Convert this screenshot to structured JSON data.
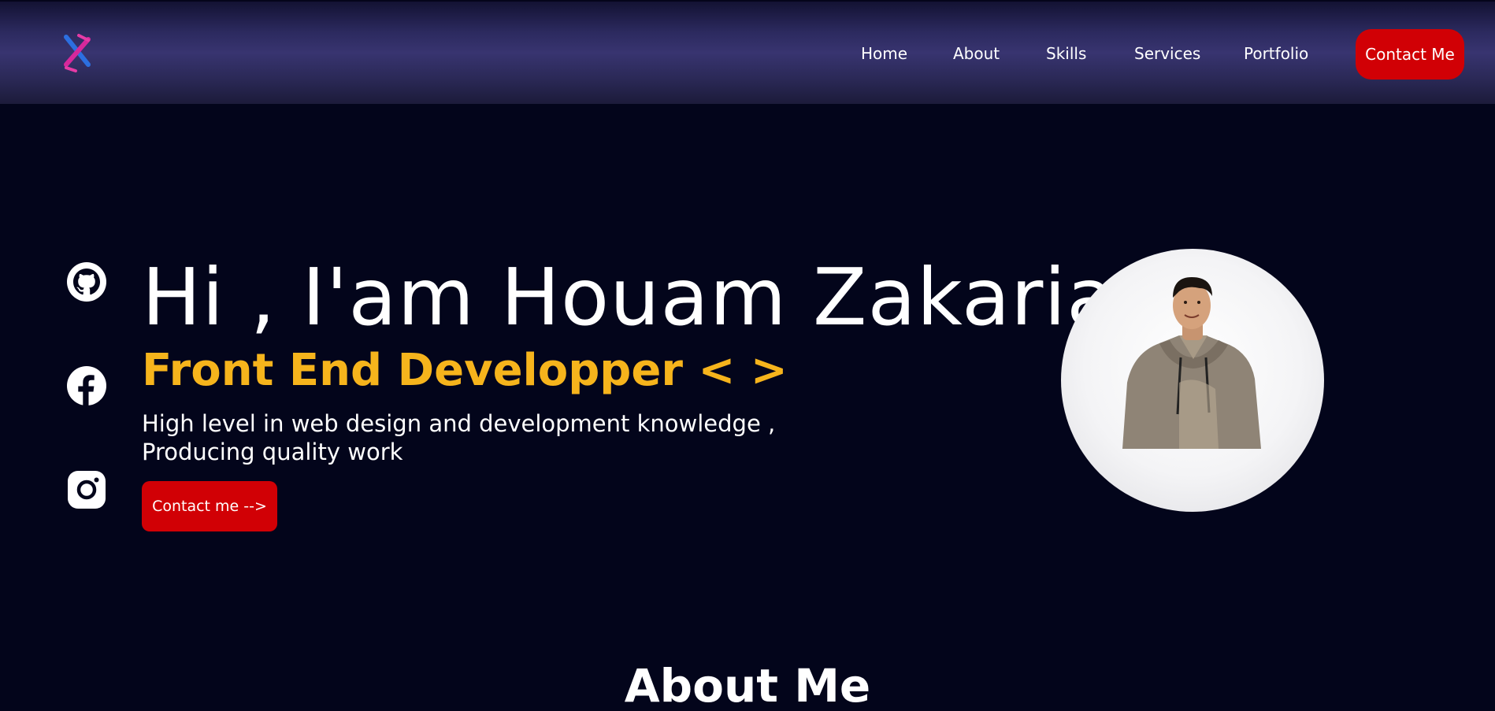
{
  "navbar": {
    "logo_icon": "x-logo-icon",
    "links": [
      {
        "label": "Home"
      },
      {
        "label": "About"
      },
      {
        "label": "Skills"
      },
      {
        "label": "Services"
      },
      {
        "label": "Portfolio"
      }
    ],
    "cta_label": "Contact Me"
  },
  "social": [
    {
      "icon": "github-icon"
    },
    {
      "icon": "facebook-icon"
    },
    {
      "icon": "instagram-icon"
    }
  ],
  "hero": {
    "title": "Hi , I'am Houam Zakaria",
    "role": "Front End Developper < >",
    "description_line1": "High level in web design and development knowledge ,",
    "description_line2": "Producing quality work",
    "cta_label": "Contact me -->"
  },
  "about": {
    "heading": "About Me"
  },
  "colors": {
    "background": "#03051b",
    "accent_red": "#d10005",
    "role_yellow": "#f6b41c",
    "nav_gradient_mid": "#383470"
  }
}
